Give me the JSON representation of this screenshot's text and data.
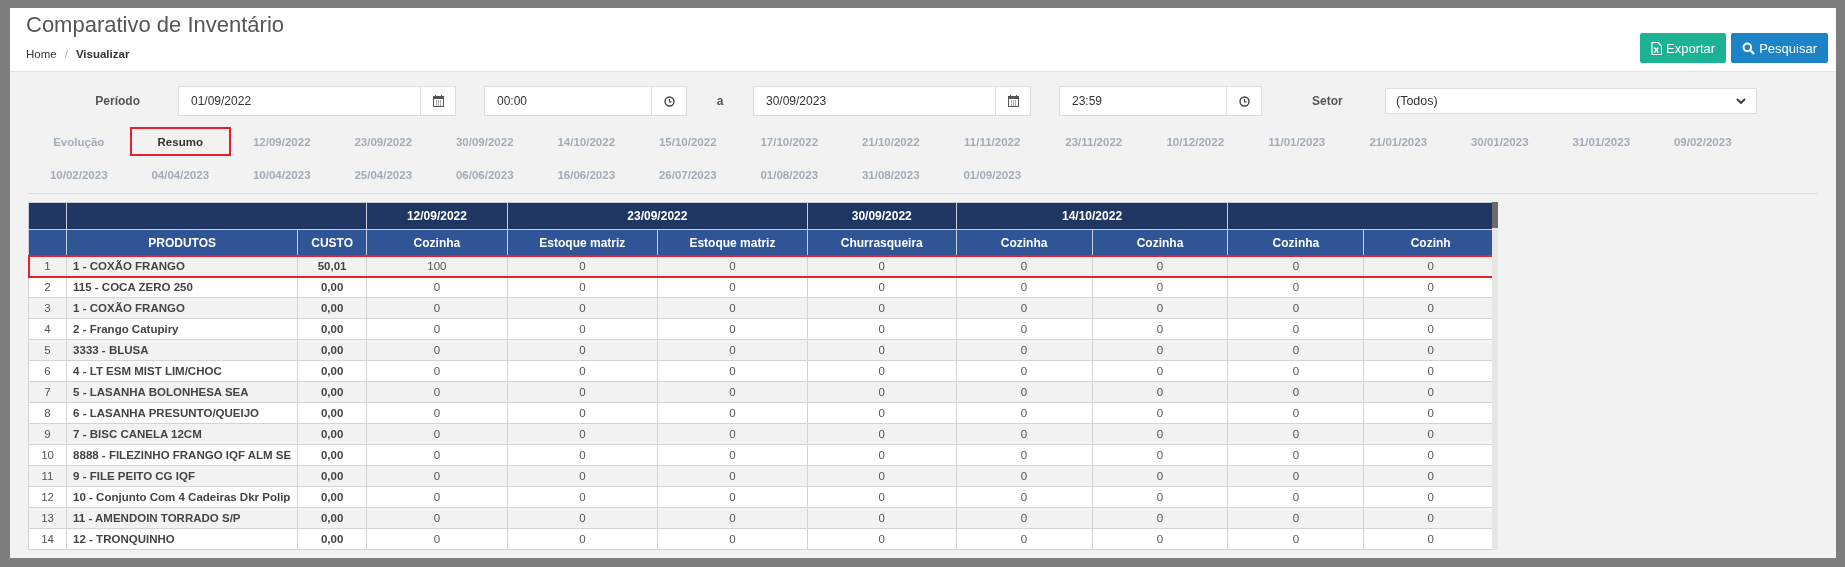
{
  "header": {
    "title": "Comparativo de Inventário",
    "breadcrumb_separator": "/",
    "breadcrumb": [
      {
        "label": "Home",
        "current": false
      },
      {
        "label": "Visualizar",
        "current": true
      }
    ],
    "actions": [
      {
        "kind": "export",
        "label": "Exportar"
      },
      {
        "kind": "search",
        "label": "Pesquisar"
      }
    ]
  },
  "filters": {
    "period_label": "Período",
    "date_from": "01/09/2022",
    "time_from": "00:00",
    "separator": "a",
    "date_to": "30/09/2023",
    "time_to": "23:59",
    "sector_label": "Setor",
    "sector": "(Todos)"
  },
  "tabs": [
    {
      "label": "Evolução",
      "selected": false
    },
    {
      "label": "Resumo",
      "selected": true
    },
    {
      "label": "12/09/2022",
      "selected": false
    },
    {
      "label": "23/09/2022",
      "selected": false
    },
    {
      "label": "30/09/2022",
      "selected": false
    },
    {
      "label": "14/10/2022",
      "selected": false
    },
    {
      "label": "15/10/2022",
      "selected": false
    },
    {
      "label": "17/10/2022",
      "selected": false
    },
    {
      "label": "21/10/2022",
      "selected": false
    },
    {
      "label": "11/11/2022",
      "selected": false
    },
    {
      "label": "23/11/2022",
      "selected": false
    },
    {
      "label": "10/12/2022",
      "selected": false
    },
    {
      "label": "11/01/2023",
      "selected": false
    },
    {
      "label": "21/01/2023",
      "selected": false
    },
    {
      "label": "30/01/2023",
      "selected": false
    },
    {
      "label": "31/01/2023",
      "selected": false
    },
    {
      "label": "09/02/2023",
      "selected": false
    },
    {
      "label": "10/02/2023",
      "selected": false
    },
    {
      "label": "04/04/2023",
      "selected": false
    },
    {
      "label": "10/04/2023",
      "selected": false
    },
    {
      "label": "25/04/2023",
      "selected": false
    },
    {
      "label": "06/06/2023",
      "selected": false
    },
    {
      "label": "16/06/2023",
      "selected": false
    },
    {
      "label": "26/07/2023",
      "selected": false
    },
    {
      "label": "01/08/2023",
      "selected": false
    },
    {
      "label": "31/08/2023",
      "selected": false
    },
    {
      "label": "01/09/2023",
      "selected": false
    }
  ],
  "table": {
    "column_groups": [
      {
        "columns": [
          "PRODUTOS",
          "CUSTO"
        ]
      },
      {
        "label": "12/09/2022",
        "columns": [
          "Cozinha"
        ]
      },
      {
        "label": "23/09/2022",
        "columns": [
          "Estoque matriz",
          "Estoque matriz"
        ]
      },
      {
        "label": "30/09/2022",
        "columns": [
          "Churrasqueira"
        ]
      },
      {
        "label": "14/10/2022",
        "columns": [
          "Cozinha",
          "Cozinha"
        ]
      },
      {
        "columns": [
          "Cozinha",
          "Cozinh"
        ]
      }
    ],
    "rows": [
      {
        "number": "1",
        "product": "1 - COXÃO FRANGO",
        "cost": "50,01",
        "values": [
          "100",
          "0",
          "0",
          "0",
          "0",
          "0",
          "0",
          "0"
        ],
        "highlighted": true
      },
      {
        "number": "2",
        "product": "115 - COCA ZERO 250",
        "cost": "0,00",
        "values": [
          "0",
          "0",
          "0",
          "0",
          "0",
          "0",
          "0",
          "0"
        ],
        "highlighted": false
      },
      {
        "number": "3",
        "product": "1 - COXÃO FRANGO",
        "cost": "0,00",
        "values": [
          "0",
          "0",
          "0",
          "0",
          "0",
          "0",
          "0",
          "0"
        ],
        "highlighted": false
      },
      {
        "number": "4",
        "product": "2 - Frango Catupiry",
        "cost": "0,00",
        "values": [
          "0",
          "0",
          "0",
          "0",
          "0",
          "0",
          "0",
          "0"
        ],
        "highlighted": false
      },
      {
        "number": "5",
        "product": "3333 - BLUSA",
        "cost": "0,00",
        "values": [
          "0",
          "0",
          "0",
          "0",
          "0",
          "0",
          "0",
          "0"
        ],
        "highlighted": false
      },
      {
        "number": "6",
        "product": "4 - LT ESM MIST LIM/CHOC",
        "cost": "0,00",
        "values": [
          "0",
          "0",
          "0",
          "0",
          "0",
          "0",
          "0",
          "0"
        ],
        "highlighted": false
      },
      {
        "number": "7",
        "product": "5 - LASANHA BOLONHESA SEA",
        "cost": "0,00",
        "values": [
          "0",
          "0",
          "0",
          "0",
          "0",
          "0",
          "0",
          "0"
        ],
        "highlighted": false
      },
      {
        "number": "8",
        "product": "6 - LASANHA PRESUNTO/QUEIJO",
        "cost": "0,00",
        "values": [
          "0",
          "0",
          "0",
          "0",
          "0",
          "0",
          "0",
          "0"
        ],
        "highlighted": false
      },
      {
        "number": "9",
        "product": "7 - BISC CANELA 12CM",
        "cost": "0,00",
        "values": [
          "0",
          "0",
          "0",
          "0",
          "0",
          "0",
          "0",
          "0"
        ],
        "highlighted": false
      },
      {
        "number": "10",
        "product": "8888 - FILEZINHO FRANGO IQF ALM SE",
        "cost": "0,00",
        "values": [
          "0",
          "0",
          "0",
          "0",
          "0",
          "0",
          "0",
          "0"
        ],
        "highlighted": false
      },
      {
        "number": "11",
        "product": "9 - FILE PEITO CG IQF",
        "cost": "0,00",
        "values": [
          "0",
          "0",
          "0",
          "0",
          "0",
          "0",
          "0",
          "0"
        ],
        "highlighted": false
      },
      {
        "number": "12",
        "product": "10 - Conjunto Com 4 Cadeiras Dkr Polip",
        "cost": "0,00",
        "values": [
          "0",
          "0",
          "0",
          "0",
          "0",
          "0",
          "0",
          "0"
        ],
        "highlighted": false
      },
      {
        "number": "13",
        "product": "11 - AMENDOIN TORRADO S/P",
        "cost": "0,00",
        "values": [
          "0",
          "0",
          "0",
          "0",
          "0",
          "0",
          "0",
          "0"
        ],
        "highlighted": false
      },
      {
        "number": "14",
        "product": "12 - TRONQUINHO",
        "cost": "0,00",
        "values": [
          "0",
          "0",
          "0",
          "0",
          "0",
          "0",
          "0",
          "0"
        ],
        "highlighted": false
      }
    ]
  }
}
